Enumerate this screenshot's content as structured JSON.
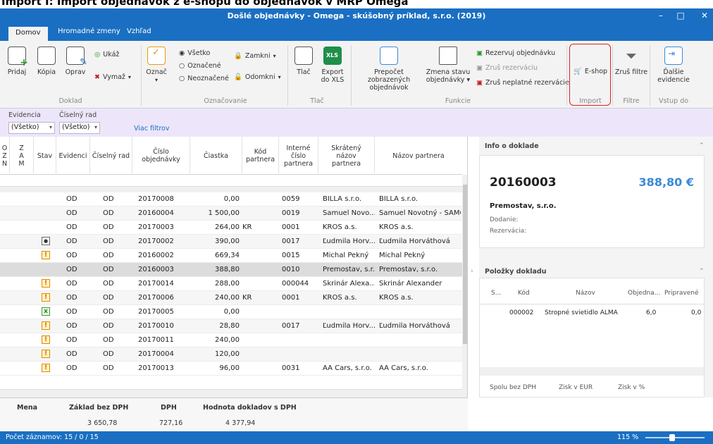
{
  "top_caption": "Import I: Import objednávok z e-shopu do objednávok v MRP Omega",
  "title": "Došlé objednávky - Omega - skúšobný príklad, s.r.o. (2019)",
  "menu_tabs": [
    "Domov",
    "Hromadné zmeny",
    "Vzhľad"
  ],
  "ribbon": {
    "doklad": {
      "add": "Pridaj",
      "copy": "Kópia",
      "edit": "Oprav",
      "show": "Ukáž",
      "delete": "Vymaž",
      "group": "Doklad"
    },
    "oznac": {
      "mark": "Označ",
      "all": "Všetko",
      "marked": "Označené",
      "unmarked": "Neoznačené",
      "lock": "Zamkni",
      "unlock": "Odomkni",
      "group": "Označovanie"
    },
    "tlac": {
      "print": "Tlač",
      "export": "Export",
      "export2": "do XLS",
      "group": "Tlač"
    },
    "funkcie": {
      "recalc": "Prepočet zobrazených",
      "recalc2": "objednávok",
      "status": "Zmena stavu",
      "status2": "objednávky",
      "reserve": "Rezervuj objednávku",
      "cancel_res": "Zruš rezerváciu",
      "cancel_invalid": "Zruš neplatné rezervácie",
      "group": "Funkcie"
    },
    "import": {
      "eshop": "E-shop",
      "group": "Import"
    },
    "filtre": {
      "cancel": "Zruš filtre",
      "group": "Filtre"
    },
    "vstup": {
      "more": "Ďalšie",
      "more2": "evidencie",
      "group": "Vstup do"
    }
  },
  "filter": {
    "evidencia_label": "Evidencia",
    "rad_label": "Číselný rad",
    "evidencia": "(Všetko)",
    "rad": "(Všetko)",
    "more": "Viac filtrov"
  },
  "headers": {
    "ozn": "O\nZ\nN",
    "zam": "Z\nA\nM",
    "stav": "Stav",
    "evidenci": "Evidenci",
    "rad": "Číselný rad",
    "cislo": "Číslo\nobjednávky",
    "ciastka": "Čiastka",
    "kod": "Kód\npartnera",
    "interne": "Interné\nčíslo\npartnera",
    "skrateny": "Skrátený\nnázov\npartnera",
    "nazov": "Názov partnera"
  },
  "rows": [
    {
      "stav": "",
      "ev": "OD",
      "rad": "OD",
      "cislo": "20170008",
      "ciastka": "0,00",
      "mena": "",
      "kod": "",
      "int": "0059",
      "skr": "BILLA s.r.o.",
      "naz": "BILLA s.r.o."
    },
    {
      "stav": "",
      "ev": "OD",
      "rad": "OD",
      "cislo": "20160004",
      "ciastka": "1 500,00",
      "mena": "",
      "kod": "",
      "int": "0019",
      "skr": "Samuel Novo...",
      "naz": "Samuel Novotný - SAMO"
    },
    {
      "stav": "",
      "ev": "OD",
      "rad": "OD",
      "cislo": "20170003",
      "ciastka": "264,00",
      "mena": "KR",
      "kod": "",
      "int": "0001",
      "skr": "KROS a.s.",
      "naz": "KROS a.s."
    },
    {
      "stav": "box",
      "ev": "OD",
      "rad": "OD",
      "cislo": "20170002",
      "ciastka": "390,00",
      "mena": "",
      "kod": "",
      "int": "0017",
      "skr": "Ľudmila Horv...",
      "naz": "Ľudmila Horváthová"
    },
    {
      "stav": "warn",
      "ev": "OD",
      "rad": "OD",
      "cislo": "20160002",
      "ciastka": "669,34",
      "mena": "",
      "kod": "",
      "int": "0015",
      "skr": "Michal Pekný",
      "naz": "Michal Pekný"
    },
    {
      "stav": "",
      "ev": "OD",
      "rad": "OD",
      "cislo": "20160003",
      "ciastka": "388,80",
      "mena": "",
      "kod": "",
      "int": "0010",
      "skr": "Premostav, s.r.",
      "naz": "Premostav, s.r.o.",
      "sel": true
    },
    {
      "stav": "warn",
      "ev": "OD",
      "rad": "OD",
      "cislo": "20170014",
      "ciastka": "288,00",
      "mena": "",
      "kod": "",
      "int": "000044",
      "skr": "Škrinár Alexa...",
      "naz": "Škrinár Alexander"
    },
    {
      "stav": "warn",
      "ev": "OD",
      "rad": "OD",
      "cislo": "20170006",
      "ciastka": "240,00",
      "mena": "KR",
      "kod": "",
      "int": "0001",
      "skr": "KROS a.s.",
      "naz": "KROS a.s."
    },
    {
      "stav": "xx",
      "ev": "OD",
      "rad": "OD",
      "cislo": "20170005",
      "ciastka": "0,00",
      "mena": "",
      "kod": "",
      "int": "",
      "skr": "",
      "naz": ""
    },
    {
      "stav": "warn",
      "ev": "OD",
      "rad": "OD",
      "cislo": "20170010",
      "ciastka": "28,80",
      "mena": "",
      "kod": "",
      "int": "0017",
      "skr": "Ľudmila Horv...",
      "naz": "Ľudmila Horváthová"
    },
    {
      "stav": "warn",
      "ev": "OD",
      "rad": "OD",
      "cislo": "20170011",
      "ciastka": "240,00",
      "mena": "",
      "kod": "",
      "int": "",
      "skr": "",
      "naz": ""
    },
    {
      "stav": "warn",
      "ev": "OD",
      "rad": "OD",
      "cislo": "20170004",
      "ciastka": "120,00",
      "mena": "",
      "kod": "",
      "int": "",
      "skr": "",
      "naz": ""
    },
    {
      "stav": "warn",
      "ev": "OD",
      "rad": "OD",
      "cislo": "20170013",
      "ciastka": "96,00",
      "mena": "",
      "kod": "",
      "int": "0031",
      "skr": "AA Cars, s.r.o.",
      "naz": "AA Cars, s.r.o."
    }
  ],
  "info": {
    "title": "Info o doklade",
    "number": "20160003",
    "amount": "388,80 €",
    "partner": "Premostav, s.r.o.",
    "dodanie": "Dodanie:",
    "rezervacia": "Rezervácia:"
  },
  "polozky": {
    "title": "Položky dokladu",
    "cols": [
      "S...",
      "Kód",
      "Názov",
      "Objedna...",
      "Pripravené"
    ],
    "row": {
      "kod": "000002",
      "nazov": "Stropné svietidlo ALMA",
      "obj": "6,0",
      "prip": "0,0"
    },
    "foot": [
      "Spolu bez DPH",
      "Zisk v EUR",
      "Zisk v %"
    ]
  },
  "summary": {
    "mena": "Mena",
    "zaklad": "Základ bez DPH",
    "dph": "DPH",
    "hodnota": "Hodnota dokladov s DPH",
    "zaklad_v": "3 650,78",
    "dph_v": "727,16",
    "hodnota_v": "4 377,94"
  },
  "status": {
    "count": "Počet záznamov: 15 / 0 / 15",
    "zoom": "115 %"
  },
  "colors": {
    "accent": "#1a6fc2",
    "highlight": "#e02020"
  }
}
